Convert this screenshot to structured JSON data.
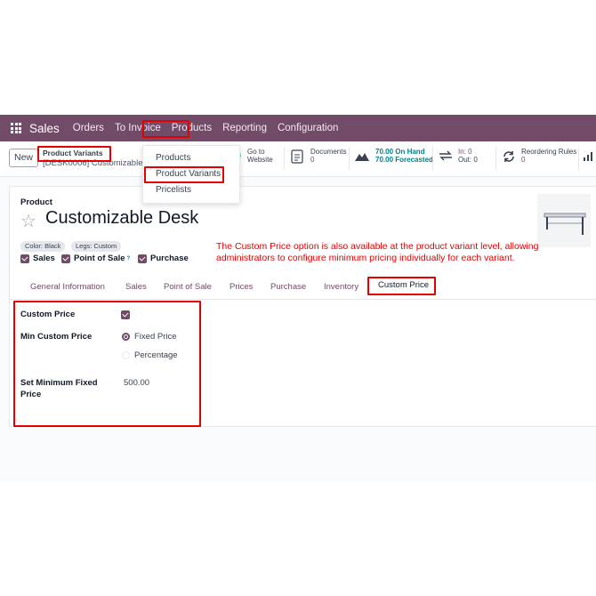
{
  "navbar": {
    "app_name": "Sales",
    "menu": [
      "Orders",
      "To Invoice",
      "Products",
      "Reporting",
      "Configuration"
    ],
    "active_menu": "Products"
  },
  "control_panel": {
    "new_label": "New",
    "breadcrumb_parent": "Product Variants",
    "breadcrumb_record": "[DESK0006] Customizable Desk"
  },
  "products_dropdown": {
    "items": [
      "Products",
      "Product Variants",
      "Pricelists"
    ],
    "highlighted": "Product Variants"
  },
  "smart_buttons": {
    "website": {
      "line1": "Go to",
      "line2": "Website"
    },
    "documents": {
      "label": "Documents",
      "count": "0"
    },
    "on_hand": {
      "value": "70.00 On Hand",
      "forecasted": "70.00 Forecasted"
    },
    "in_out": {
      "in": "In: 0",
      "out": "Out: 0"
    },
    "reordering": {
      "label": "Reordering Rules",
      "count": "0"
    }
  },
  "form": {
    "record_type": "Product",
    "title": "Customizable Desk",
    "attributes": [
      "Color: Black",
      "Legs: Custom"
    ],
    "checkboxes": [
      "Sales",
      "Point of Sale",
      "Purchase"
    ],
    "help_marker": "?",
    "annotation": "The Custom Price option is also available at the product variant level, allowing administrators to configure minimum pricing individually for each variant.",
    "tabs": [
      "General Information",
      "Sales",
      "Point of Sale",
      "Prices",
      "Purchase",
      "Inventory",
      "Custom Price"
    ],
    "active_tab": "Custom Price",
    "custom_price": {
      "custom_price_label": "Custom Price",
      "custom_price_checked": true,
      "min_custom_price_label": "Min Custom Price",
      "options": [
        "Fixed Price",
        "Percentage"
      ],
      "selected_option": "Fixed Price",
      "min_fixed_price_label": "Set Minimum Fixed Price",
      "min_fixed_price_value": "500.00"
    }
  },
  "colors": {
    "navbar": "#714b67",
    "accent": "#017e84",
    "highlight": "#e40000"
  }
}
